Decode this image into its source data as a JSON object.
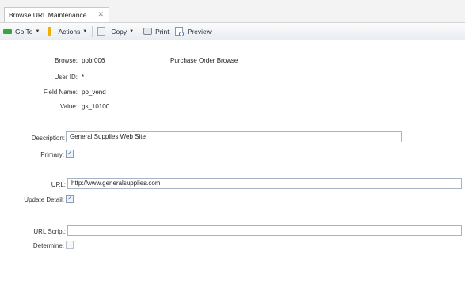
{
  "tab": {
    "title": "Browse URL Maintenance",
    "close_glyph": "✕"
  },
  "toolbar": {
    "goto_label": "Go To",
    "actions_label": "Actions",
    "copy_label": "Copy",
    "print_label": "Print",
    "preview_label": "Preview"
  },
  "form": {
    "browse_label": "Browse:",
    "browse_value": "pobr006",
    "browse_desc": "Purchase Order Browse",
    "userid_label": "User ID:",
    "userid_value": "*",
    "fieldname_label": "Field Name:",
    "fieldname_value": "po_vend",
    "value_label": "Value:",
    "value_value": "gs_10100",
    "description_label": "Description:",
    "description_value": "General Supplies Web Site",
    "primary_label": "Primary:",
    "primary_checked": true,
    "url_label": "URL:",
    "url_value": "http://www.generalsupplies.com",
    "update_detail_label": "Update Detail:",
    "update_detail_checked": true,
    "url_script_label": "URL Script:",
    "url_script_value": "",
    "determine_label": "Determine:",
    "determine_checked": false
  }
}
